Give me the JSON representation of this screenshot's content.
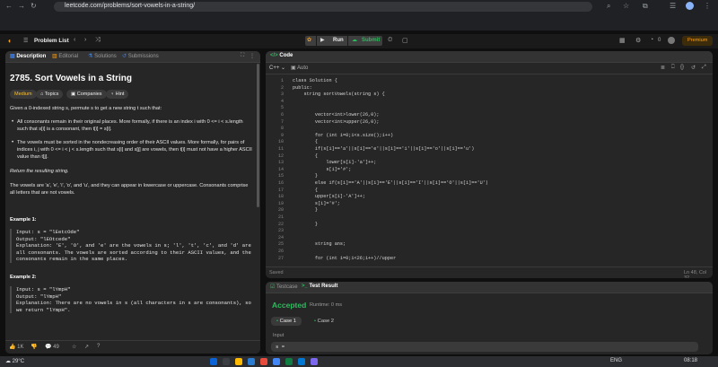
{
  "browser": {
    "url": "leetcode.com/problems/sort-vowels-in-a-string/"
  },
  "header": {
    "problem_list": "Problem List",
    "run": "Run",
    "submit": "Submit",
    "streak": "0",
    "premium": "Premium"
  },
  "left": {
    "tabs": [
      "Description",
      "Editorial",
      "Solutions",
      "Submissions"
    ],
    "title": "2785. Sort Vowels in a String",
    "chips": [
      "Medium",
      "Topics",
      "Companies",
      "Hint"
    ],
    "intro": "Given a 0-indexed string s, permute s to get a new string t such that:",
    "bullet1": "All consonants remain in their original places. More formally, if there is an index i with 0 <= i < s.length such that s[i] is a consonant, then t[i] = s[i].",
    "bullet2": "The vowels must be sorted in the nondecreasing order of their ASCII values. More formally, for pairs of indices i, j with 0 <= i < j < s.length such that s[i] and s[j] are vowels, then t[i] must not have a higher ASCII value than t[j].",
    "return": "Return the resulting string.",
    "vowels": "The vowels are 'a', 'e', 'i', 'o', and 'u', and they can appear in lowercase or uppercase. Consonants comprise all letters that are not vowels.",
    "ex1_title": "Example 1:",
    "ex1": "Input: s = \"lEetcOde\"\nOutput: \"lEOtcede\"\nExplanation: 'E', 'O', and 'e' are the vowels in s; 'l', 't', 'c', and 'd' are all consonants. The vowels are sorted according to their ASCII values, and the consonants remain in the same places.",
    "ex2_title": "Example 2:",
    "ex2": "Input: s = \"lYmpH\"\nOutput: \"lYmpH\"\nExplanation: There are no vowels in s (all characters in s are consonants), so we return \"lYmpH\".",
    "likes": "1K",
    "comments": "49"
  },
  "code": {
    "tab": "Code",
    "lang": "C++",
    "auto": "Auto",
    "lines": [
      {
        "n": "1",
        "t": "class Solution {"
      },
      {
        "n": "2",
        "t": "public:"
      },
      {
        "n": "3",
        "t": "    string sortVowels(string s) {"
      },
      {
        "n": "4",
        "t": ""
      },
      {
        "n": "5",
        "t": ""
      },
      {
        "n": "6",
        "t": "        vector<int>lower(26,0);"
      },
      {
        "n": "7",
        "t": "        vector<int>upper(26,0);"
      },
      {
        "n": "8",
        "t": ""
      },
      {
        "n": "9",
        "t": "        for (int i=0;i<s.size();i++)"
      },
      {
        "n": "10",
        "t": "        {"
      },
      {
        "n": "11",
        "t": "        if(s[i]=='a'||s[i]=='e'||s[i]=='i'||s[i]=='o'||s[i]=='u')"
      },
      {
        "n": "12",
        "t": "        {"
      },
      {
        "n": "13",
        "t": "            lower[s[i]-'a']++;"
      },
      {
        "n": "14",
        "t": "            s[i]='#';"
      },
      {
        "n": "15",
        "t": "        }"
      },
      {
        "n": "16",
        "t": "        else if(s[i]=='A'||s[i]=='E'||s[i]=='I'||s[i]=='O'||s[i]=='U')"
      },
      {
        "n": "17",
        "t": "        {"
      },
      {
        "n": "18",
        "t": "        upper[s[i]-'A']++;"
      },
      {
        "n": "19",
        "t": "        s[i]='#';"
      },
      {
        "n": "20",
        "t": "        }"
      },
      {
        "n": "21",
        "t": ""
      },
      {
        "n": "22",
        "t": "        }"
      },
      {
        "n": "23",
        "t": ""
      },
      {
        "n": "24",
        "t": ""
      },
      {
        "n": "25",
        "t": "        string ans;"
      },
      {
        "n": "26",
        "t": ""
      },
      {
        "n": "27",
        "t": "        for (int i=0;i<26;i++)//upper"
      }
    ],
    "saved": "Saved",
    "cursor": "Ln 48, Col 32"
  },
  "result": {
    "tabs": [
      "Testcase",
      "Test Result"
    ],
    "status": "Accepted",
    "runtime": "Runtime: 0 ms",
    "cases": [
      "Case 1",
      "Case 2"
    ],
    "input_label": "Input",
    "input_value": "s ="
  },
  "taskbar": {
    "temp": "29°C",
    "lang": "ENG",
    "time": "08:18"
  },
  "colors": {
    "accent": "#ffa116",
    "accepted": "#2cbb5d",
    "medium": "#ffc01e",
    "run_btn": "#3e3e3e"
  }
}
